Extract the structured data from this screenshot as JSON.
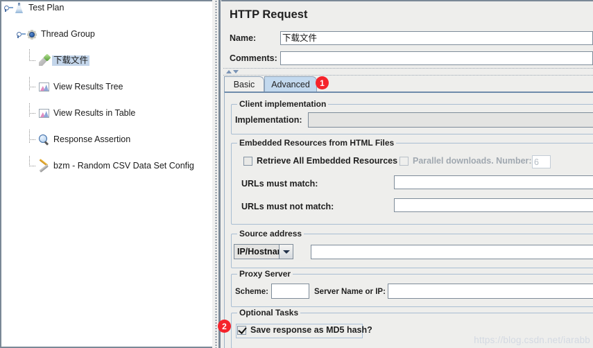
{
  "tree": {
    "items": [
      {
        "label": "Test Plan",
        "icon": "test-plan-icon",
        "selected": false,
        "depth": 0
      },
      {
        "label": "Thread Group",
        "icon": "thread-group-gear-icon",
        "selected": false,
        "depth": 1
      },
      {
        "label": "下载文件",
        "icon": "http-sampler-pen-icon",
        "selected": true,
        "depth": 2
      },
      {
        "label": "View Results Tree",
        "icon": "results-chart-icon",
        "selected": false,
        "depth": 2
      },
      {
        "label": "View Results in Table",
        "icon": "results-chart-icon",
        "selected": false,
        "depth": 2
      },
      {
        "label": "Response Assertion",
        "icon": "magnifier-icon",
        "selected": false,
        "depth": 2
      },
      {
        "label": "bzm - Random CSV Data Set Config",
        "icon": "wrench-screwdriver-icon",
        "selected": false,
        "depth": 2
      }
    ]
  },
  "panel": {
    "title": "HTTP Request",
    "name_label": "Name:",
    "name_value": "下载文件",
    "comments_label": "Comments:",
    "comments_value": ""
  },
  "tabs": [
    {
      "label": "Basic",
      "active": false
    },
    {
      "label": "Advanced",
      "active": true
    }
  ],
  "client_implementation": {
    "title": "Client implementation",
    "implementation_label": "Implementation:",
    "implementation_value": ""
  },
  "embedded_resources": {
    "title": "Embedded Resources from HTML Files",
    "retrieve_all_label": "Retrieve All Embedded Resources",
    "retrieve_all_checked": false,
    "parallel_label": "Parallel downloads. Number:",
    "parallel_checked": false,
    "parallel_value": "6",
    "urls_match_label": "URLs must match:",
    "urls_match_value": "",
    "urls_not_match_label": "URLs must not match:",
    "urls_not_match_value": ""
  },
  "source_address": {
    "title": "Source address",
    "type_value": "IP/Hostname",
    "address_value": ""
  },
  "proxy_server": {
    "title": "Proxy Server",
    "scheme_label": "Scheme:",
    "scheme_value": "",
    "server_label": "Server Name or IP:",
    "server_value": ""
  },
  "optional_tasks": {
    "title": "Optional Tasks",
    "md5_label": "Save response as MD5 hash?",
    "md5_checked": true
  },
  "annotations": [
    {
      "number": "1"
    },
    {
      "number": "2"
    }
  ],
  "watermark": "https://blog.csdn.net/iarabb",
  "colors": {
    "accent_red": "#f5232b",
    "tab_active": "#c3d9ee",
    "selection": "#c3d5ea"
  }
}
